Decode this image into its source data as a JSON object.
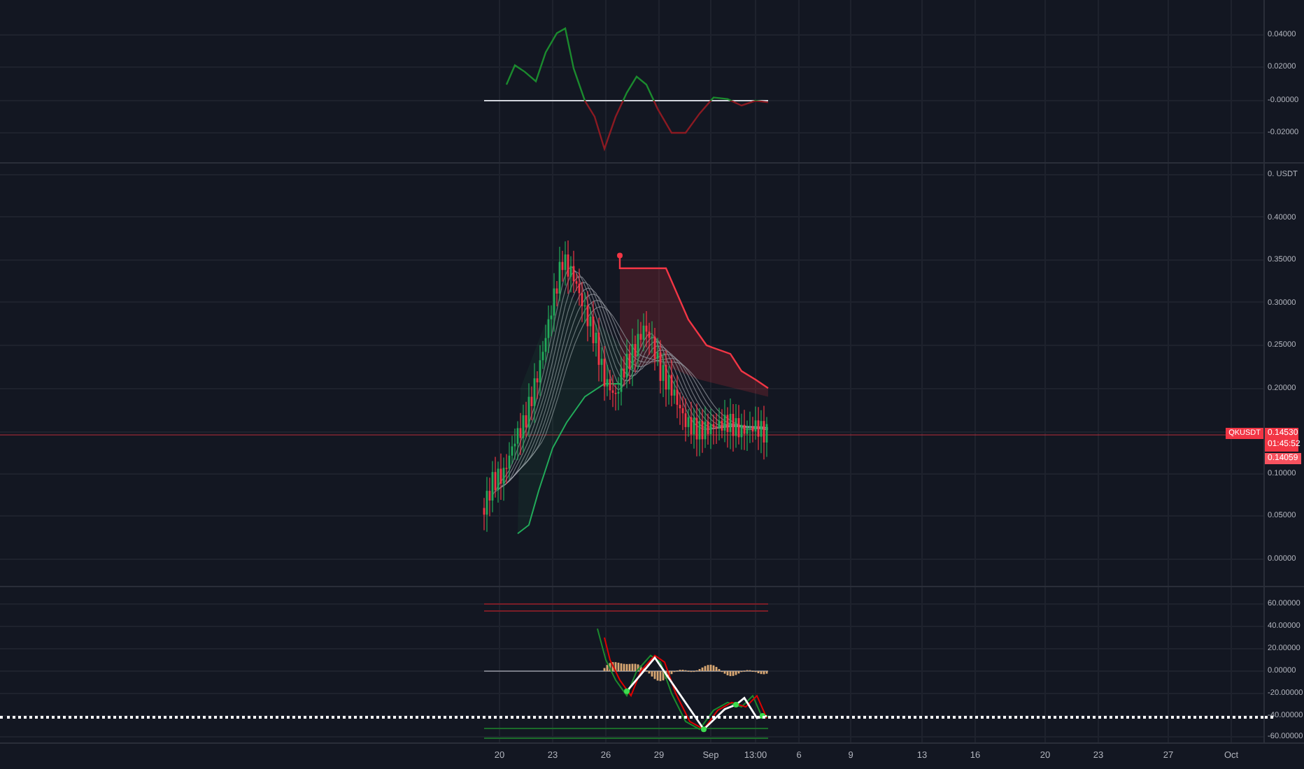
{
  "oscillator_pane": {
    "axis_labels": [
      "0.04000",
      "0.02000",
      "-0.00000",
      "-0.02000"
    ]
  },
  "price_pane": {
    "axis_labels": [
      "0. USDT",
      "0.40000",
      "0.35000",
      "0.30000",
      "0.25000",
      "0.20000",
      "0.10000",
      "0.05000",
      "0.00000"
    ],
    "symbol_tag": "QKUSDT",
    "last_price": "0.14530",
    "countdown": "01:45:52",
    "prev_price": "0.14059"
  },
  "indicator_pane": {
    "axis_labels": [
      "60.00000",
      "40.00000",
      "20.00000",
      "0.00000",
      "-20.00000",
      "-40.00000",
      "-60.00000"
    ]
  },
  "time_axis": {
    "labels": [
      "20",
      "23",
      "26",
      "29",
      "Sep",
      "13:00",
      "6",
      "9",
      "13",
      "16",
      "20",
      "23",
      "27",
      "Oct"
    ]
  }
}
